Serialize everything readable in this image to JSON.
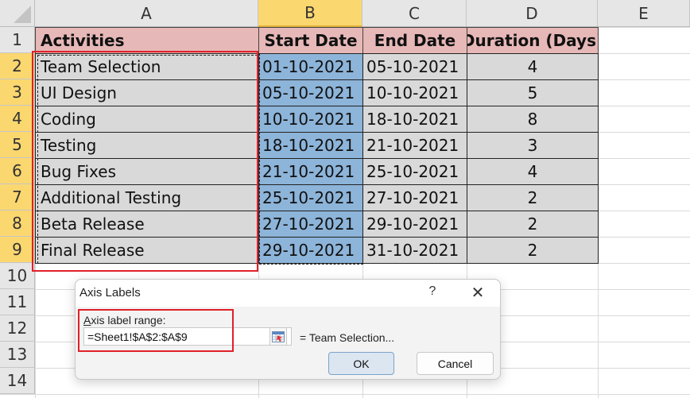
{
  "spreadsheet": {
    "columns": [
      "A",
      "B",
      "C",
      "D",
      "E"
    ],
    "selected_column": "B",
    "rows": [
      "1",
      "2",
      "3",
      "4",
      "5",
      "6",
      "7",
      "8",
      "9",
      "10",
      "11",
      "12",
      "13",
      "14"
    ],
    "headers": [
      "Activities",
      "Start Date",
      "End Date",
      "Duration (Days)"
    ],
    "data": [
      {
        "activity": "Team Selection",
        "start": "01-10-2021",
        "end": "05-10-2021",
        "duration": "4"
      },
      {
        "activity": "UI Design",
        "start": "05-10-2021",
        "end": "10-10-2021",
        "duration": "5"
      },
      {
        "activity": "Coding",
        "start": "10-10-2021",
        "end": "18-10-2021",
        "duration": "8"
      },
      {
        "activity": "Testing",
        "start": "18-10-2021",
        "end": "21-10-2021",
        "duration": "3"
      },
      {
        "activity": "Bug Fixes",
        "start": "21-10-2021",
        "end": "25-10-2021",
        "duration": "4"
      },
      {
        "activity": "Additional Testing",
        "start": "25-10-2021",
        "end": "27-10-2021",
        "duration": "2"
      },
      {
        "activity": "Beta Release",
        "start": "27-10-2021",
        "end": "29-10-2021",
        "duration": "2"
      },
      {
        "activity": "Final Release",
        "start": "29-10-2021",
        "end": "31-10-2021",
        "duration": "2"
      }
    ],
    "colors": {
      "header_fill": "#e6b8b7",
      "data_fill": "#d9d9d9",
      "start_date_fill": "#8db4d9",
      "highlight_box": "#e0202a"
    }
  },
  "dialog": {
    "title": "Axis Labels",
    "help_label": "?",
    "close_label": "✕",
    "field_label_accel": "A",
    "field_label_rest": "xis label range:",
    "range_value": "=Sheet1!$A$2:$A$9",
    "preview": "= Team Selection...",
    "ok_label": "OK",
    "cancel_label": "Cancel",
    "range_button_icon": "collapse-dialog-icon"
  }
}
